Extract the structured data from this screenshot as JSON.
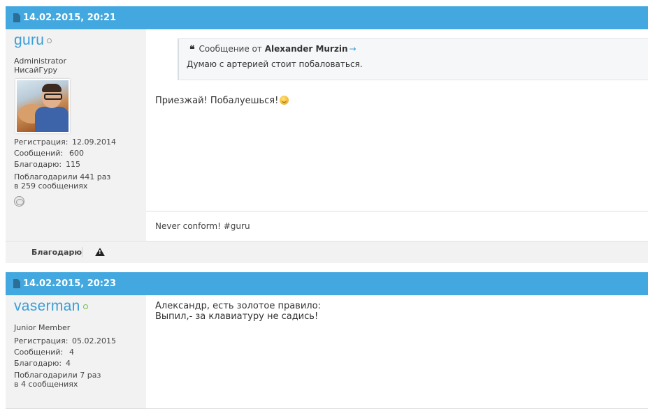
{
  "posts": [
    {
      "date": "14.02.2015, 20:21",
      "user": {
        "name": "guru",
        "title_line1": "Administrator",
        "title_line2": "НисайГуру",
        "reg_label": "Регистрация:",
        "reg_value": "12.09.2014",
        "msgs_label": "Сообщений:",
        "msgs_value": "600",
        "thanks_label": "Благодарю:",
        "thanks_value": "115",
        "thanked_line1": "Поблагодарили 441 раз",
        "thanked_line2": "в 259 сообщениях"
      },
      "quote": {
        "prefix": "Сообщение от",
        "author": "Alexander Murzin",
        "text": "Думаю с артерией стоит побаловаться."
      },
      "message": "Приезжай! Побалуешься!",
      "signature": "Never conform! #guru",
      "footer": {
        "thank_label": "Благодарю"
      }
    },
    {
      "date": "14.02.2015, 20:23",
      "user": {
        "name": "vaserman",
        "title_line1": "Junior Member",
        "reg_label": "Регистрация:",
        "reg_value": "05.02.2015",
        "msgs_label": "Сообщений:",
        "msgs_value": "4",
        "thanks_label": "Благодарю:",
        "thanks_value": "4",
        "thanked_line1": "Поблагодарили 7 раз",
        "thanked_line2": "в 4 сообщениях"
      },
      "message_line1": "Александр, есть золотое правило:",
      "message_line2": "Выпил,- за клавиатуру не садись!"
    }
  ],
  "colors": {
    "header": "#42a8df",
    "username": "#3a9dd5",
    "sidebar": "#f2f2f2"
  }
}
